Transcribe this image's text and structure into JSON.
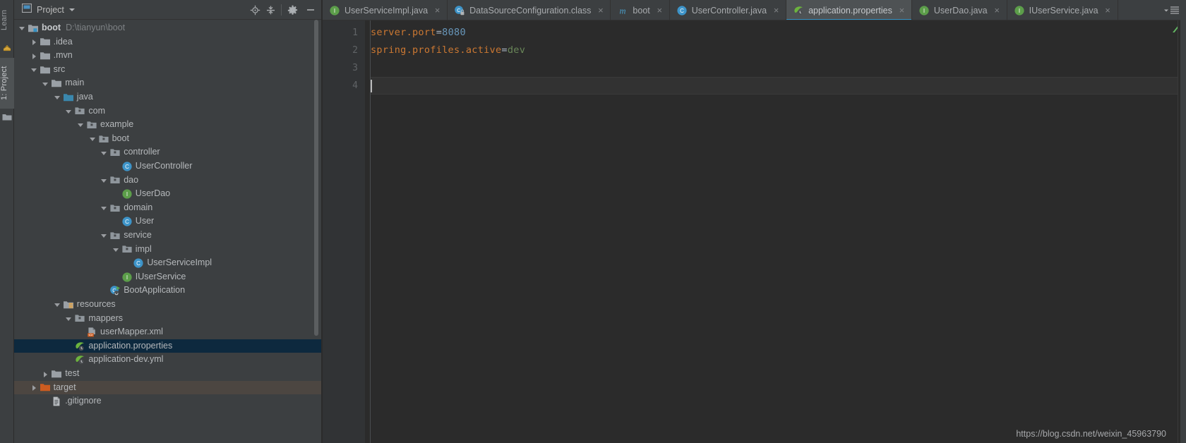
{
  "rail": {
    "learn_label": "Learn",
    "project_label": "1: Project",
    "learn_icon": "graduation-crown-icon",
    "project_icon": "folder-icon"
  },
  "project_panel": {
    "title": "Project",
    "dropdown_icon": "chevron-down-icon",
    "tools": [
      {
        "name": "scroll-from-source-icon",
        "tooltip": "Select Opened File"
      },
      {
        "name": "collapse-all-icon",
        "tooltip": "Collapse All"
      },
      {
        "name": "gear-icon",
        "tooltip": "Settings"
      },
      {
        "name": "hide-icon",
        "tooltip": "Hide"
      }
    ],
    "tree": [
      {
        "depth": 0,
        "arrow": "open",
        "icon": "module-folder-icon",
        "label": "boot",
        "bold": true,
        "sub": "D:\\tianyun\\boot",
        "state": "normal"
      },
      {
        "depth": 1,
        "arrow": "closed",
        "icon": "folder-icon",
        "label": ".idea",
        "state": "normal"
      },
      {
        "depth": 1,
        "arrow": "closed",
        "icon": "folder-icon",
        "label": ".mvn",
        "state": "normal"
      },
      {
        "depth": 1,
        "arrow": "open",
        "icon": "folder-icon",
        "label": "src",
        "state": "normal"
      },
      {
        "depth": 2,
        "arrow": "open",
        "icon": "folder-icon",
        "label": "main",
        "state": "normal"
      },
      {
        "depth": 3,
        "arrow": "open",
        "icon": "source-root-icon",
        "label": "java",
        "state": "normal"
      },
      {
        "depth": 4,
        "arrow": "open",
        "icon": "package-icon",
        "label": "com",
        "state": "normal"
      },
      {
        "depth": 5,
        "arrow": "open",
        "icon": "package-icon",
        "label": "example",
        "state": "normal"
      },
      {
        "depth": 6,
        "arrow": "open",
        "icon": "package-icon",
        "label": "boot",
        "state": "normal"
      },
      {
        "depth": 7,
        "arrow": "open",
        "icon": "package-icon",
        "label": "controller",
        "state": "normal"
      },
      {
        "depth": 8,
        "arrow": "none",
        "icon": "java-class-icon",
        "label": "UserController",
        "state": "normal"
      },
      {
        "depth": 7,
        "arrow": "open",
        "icon": "package-icon",
        "label": "dao",
        "state": "normal"
      },
      {
        "depth": 8,
        "arrow": "none",
        "icon": "java-interface-icon",
        "label": "UserDao",
        "state": "normal"
      },
      {
        "depth": 7,
        "arrow": "open",
        "icon": "package-icon",
        "label": "domain",
        "state": "normal"
      },
      {
        "depth": 8,
        "arrow": "none",
        "icon": "java-class-icon",
        "label": "User",
        "state": "normal"
      },
      {
        "depth": 7,
        "arrow": "open",
        "icon": "package-icon",
        "label": "service",
        "state": "normal"
      },
      {
        "depth": 8,
        "arrow": "open",
        "icon": "package-icon",
        "label": "impl",
        "state": "normal"
      },
      {
        "depth": 9,
        "arrow": "none",
        "icon": "java-class-icon",
        "label": "UserServiceImpl",
        "state": "normal"
      },
      {
        "depth": 8,
        "arrow": "none",
        "icon": "java-interface-icon",
        "label": "IUserService",
        "state": "normal"
      },
      {
        "depth": 7,
        "arrow": "none",
        "icon": "spring-boot-run-class-icon",
        "label": "BootApplication",
        "state": "normal"
      },
      {
        "depth": 3,
        "arrow": "open",
        "icon": "resources-root-icon",
        "label": "resources",
        "state": "normal"
      },
      {
        "depth": 4,
        "arrow": "open",
        "icon": "package-icon",
        "label": "mappers",
        "state": "normal"
      },
      {
        "depth": 5,
        "arrow": "none",
        "icon": "xml-file-icon",
        "label": "userMapper.xml",
        "state": "normal"
      },
      {
        "depth": 4,
        "arrow": "none",
        "icon": "spring-properties-icon",
        "label": "application.properties",
        "state": "selected"
      },
      {
        "depth": 4,
        "arrow": "none",
        "icon": "spring-properties-icon",
        "label": "application-dev.yml",
        "state": "normal"
      },
      {
        "depth": 2,
        "arrow": "closed",
        "icon": "folder-icon",
        "label": "test",
        "state": "normal"
      },
      {
        "depth": 1,
        "arrow": "closed",
        "icon": "excluded-folder-icon",
        "label": "target",
        "state": "hovered"
      },
      {
        "depth": 2,
        "arrow": "none",
        "icon": "text-file-icon",
        "label": ".gitignore",
        "state": "normal"
      }
    ]
  },
  "tabs": {
    "items": [
      {
        "label": "UserServiceImpl.java",
        "icon": "java-interface-icon",
        "active": false,
        "close": "×"
      },
      {
        "label": "DataSourceConfiguration.class",
        "icon": "java-class-locked-icon",
        "active": false,
        "close": "×"
      },
      {
        "label": "boot",
        "icon": "maven-module-icon",
        "active": false,
        "close": "×"
      },
      {
        "label": "UserController.java",
        "icon": "java-class-icon",
        "active": false,
        "close": "×"
      },
      {
        "label": "application.properties",
        "icon": "spring-properties-icon",
        "active": true,
        "close": "×"
      },
      {
        "label": "UserDao.java",
        "icon": "java-interface-icon",
        "active": false,
        "close": "×"
      },
      {
        "label": "IUserService.java",
        "icon": "java-interface-icon",
        "active": false,
        "close": "×"
      }
    ],
    "overflow_icon": "tab-list-dropdown-icon"
  },
  "editor": {
    "line_numbers": [
      "1",
      "2",
      "3",
      "4"
    ],
    "current_line": 4,
    "lines": [
      {
        "num": "1",
        "key": "server.port",
        "eq": "=",
        "value": "8080",
        "value_kind": "number"
      },
      {
        "num": "2",
        "key": "spring.profiles.active",
        "eq": "=",
        "value": "dev",
        "value_kind": "string"
      },
      {
        "num": "3",
        "key": "",
        "eq": "",
        "value": "",
        "value_kind": "none"
      },
      {
        "num": "4",
        "key": "",
        "eq": "",
        "value": "",
        "value_kind": "none"
      }
    ],
    "marker_icon": "inspection-marker-icon"
  },
  "watermark": {
    "text": "https://blog.csdn.net/weixin_45963790"
  },
  "colors": {
    "panel_bg": "#3c3f41",
    "editor_bg": "#2b2b2b",
    "gutter_bg": "#313335",
    "selection_bg": "#0d293e",
    "hover_bg": "#4c4641",
    "accent": "#3592c4",
    "key_orange": "#cc7832",
    "number_blue": "#6897bb",
    "string_green": "#6a8759",
    "text_fg": "#a9b7c6"
  }
}
